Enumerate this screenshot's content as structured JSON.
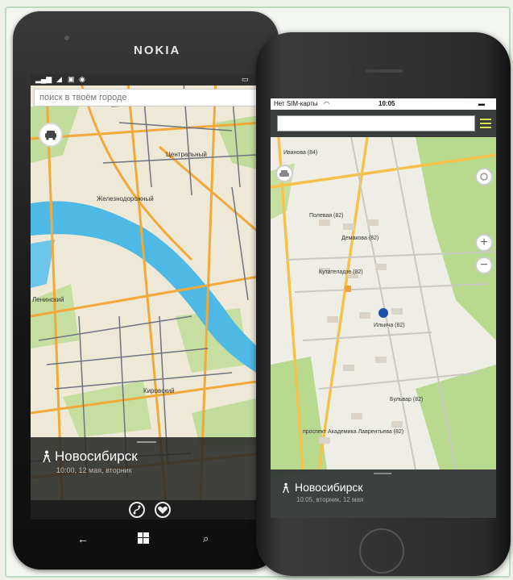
{
  "nokia": {
    "brand": "NOKIA",
    "search_placeholder": "поиск в твоём городе",
    "map_labels": {
      "central": "Центральный",
      "railway": "Железнодорожный",
      "leninsky": "Ленинский",
      "kirovsky": "Кировский"
    },
    "panel": {
      "city": "Новосибирск",
      "time": "10:00, 12 мая, вторник"
    }
  },
  "iphone": {
    "status": {
      "carrier": "Нет SIM-карты",
      "time": "10:05"
    },
    "map_labels": {
      "street1": "Иванова (84)",
      "street2": "Полевая (82)",
      "street3": "Демакова (82)",
      "street4": "Кутателадзе (82)",
      "street5": "Ильича (82)",
      "street6": "Бульвар (82)",
      "avenue": "проспект Академика Лаврентьева (82)"
    },
    "zoom_in": "+",
    "zoom_out": "−",
    "panel": {
      "city": "Новосибирск",
      "time": "10:05, вторник, 12 мая"
    }
  },
  "colors": {
    "road": "#f1a93a",
    "water": "#4fb9e6",
    "green": "#b7d98b",
    "menu_accent": "#d6e04a"
  }
}
